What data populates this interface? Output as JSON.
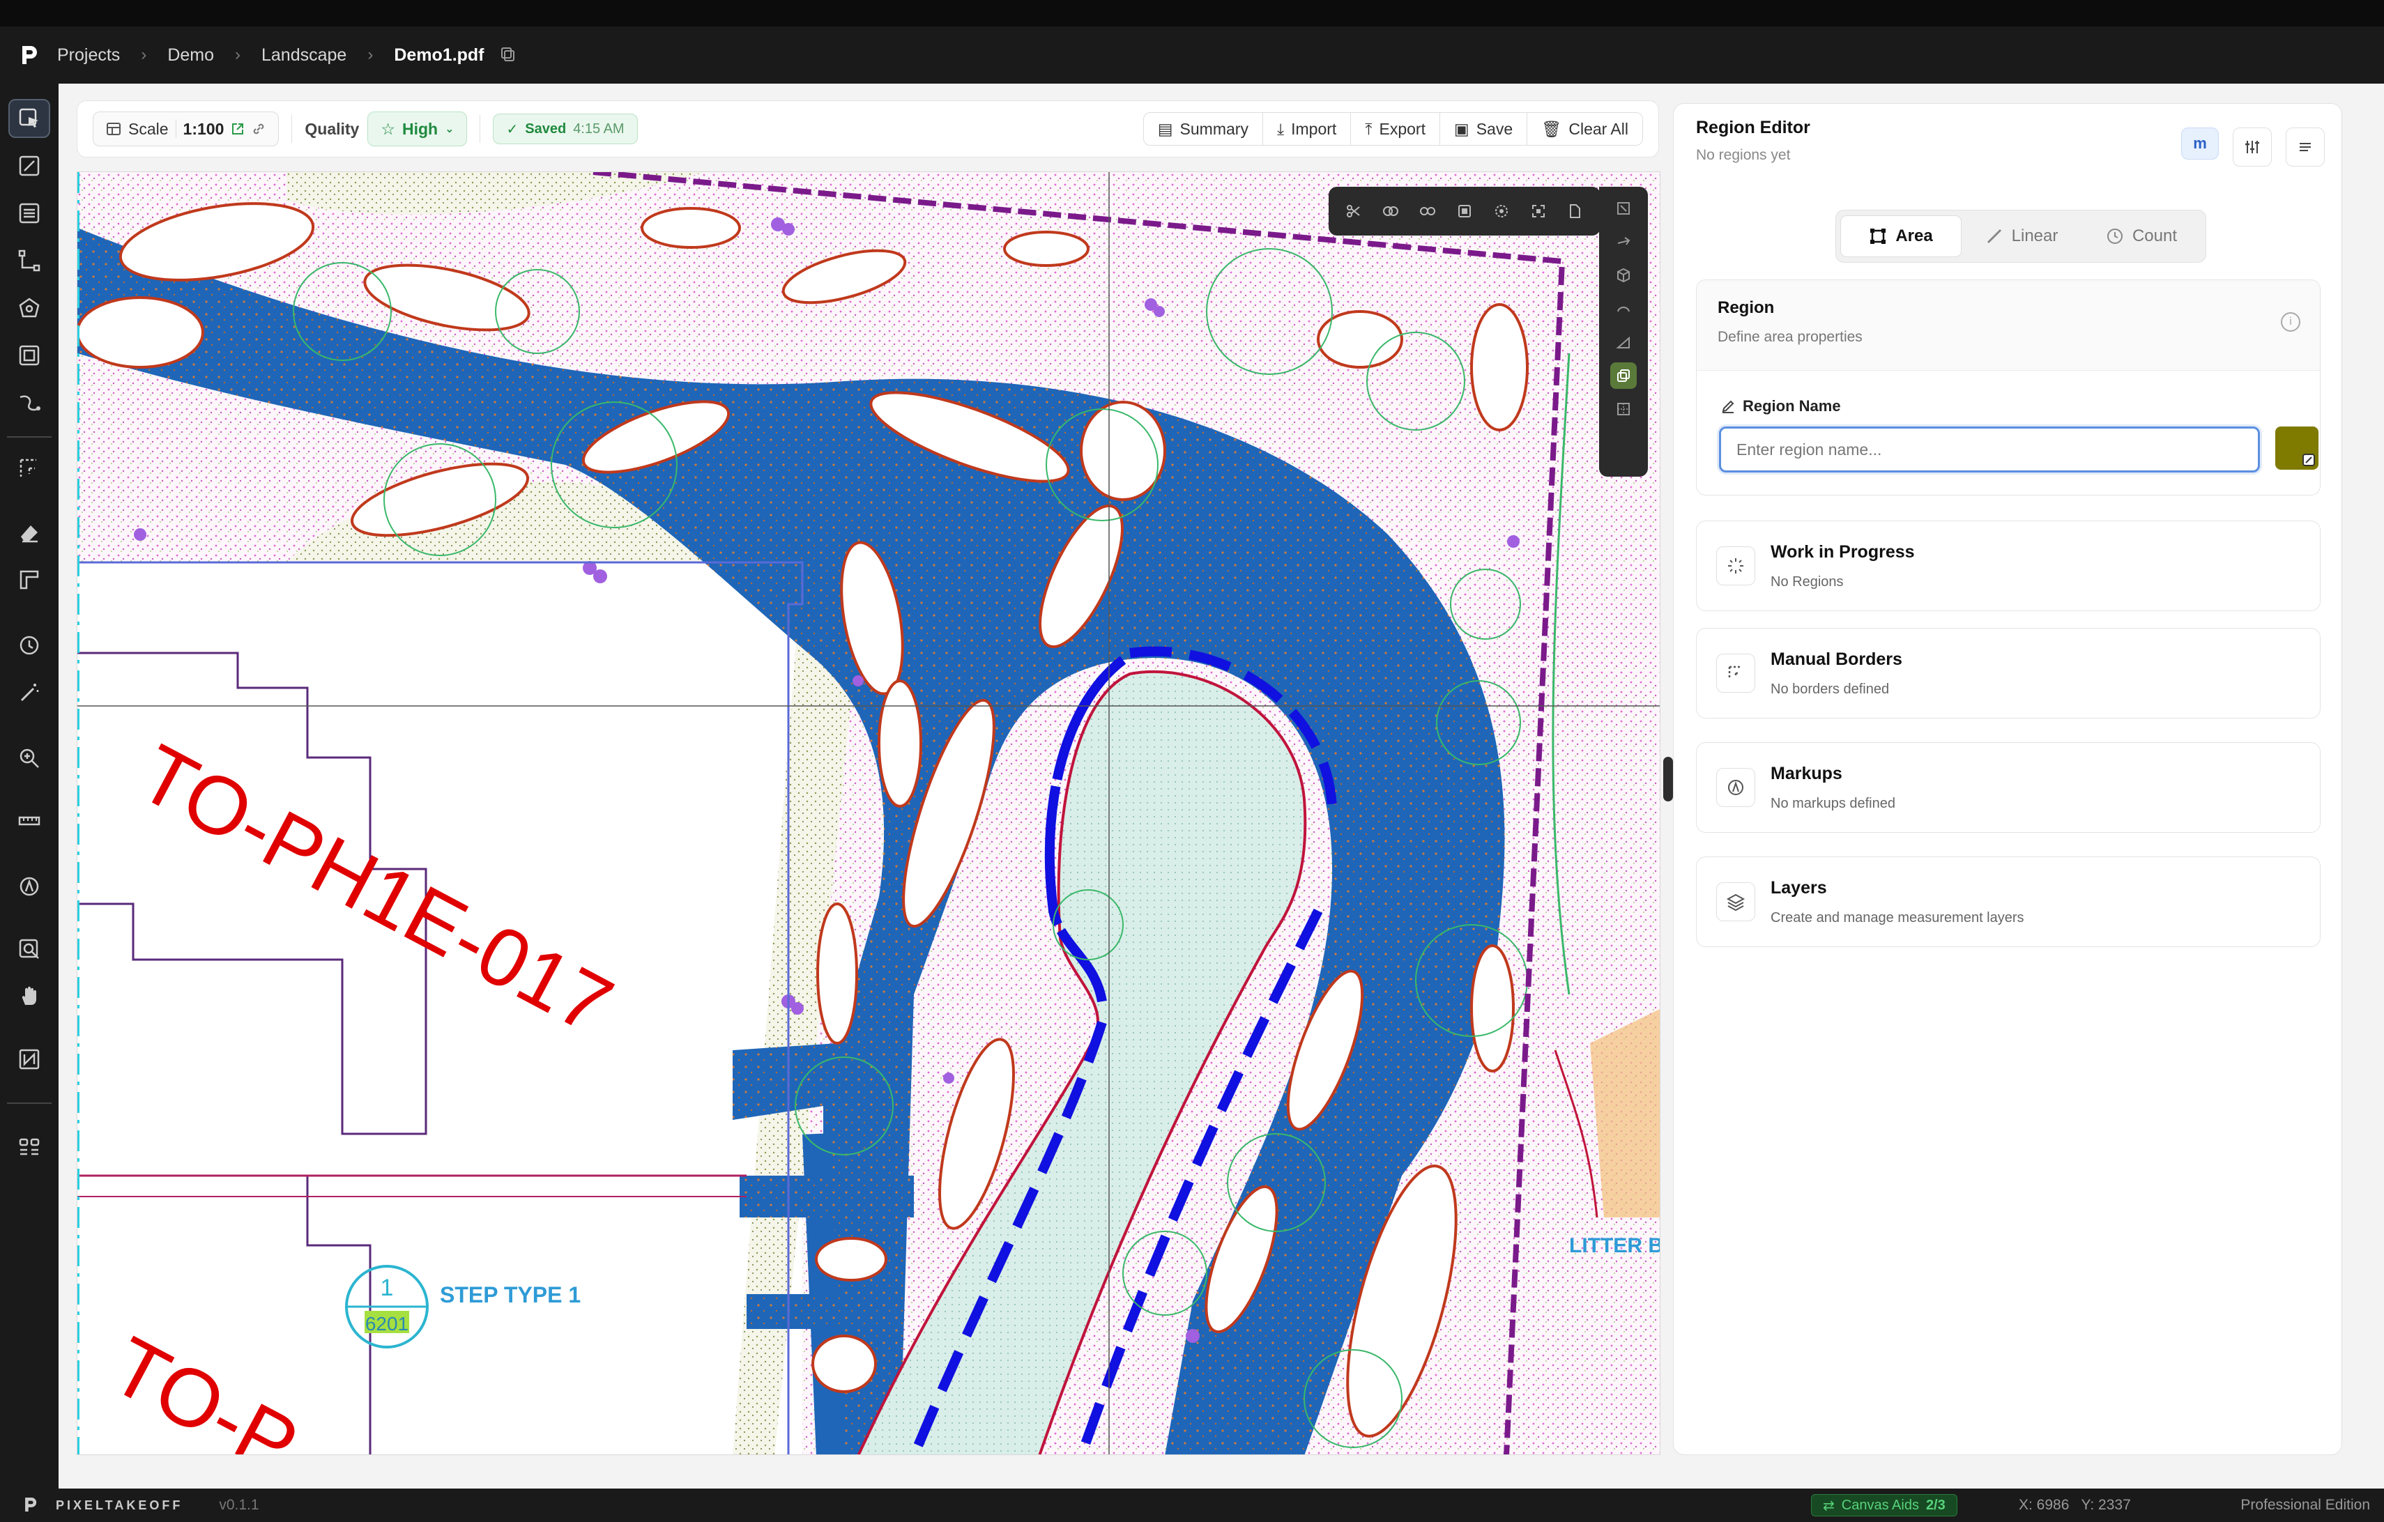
{
  "breadcrumb": {
    "items": [
      "Projects",
      "Demo",
      "Landscape"
    ],
    "current": "Demo1.pdf"
  },
  "toolbar": {
    "scale_label": "Scale",
    "scale_value": "1:100",
    "quality_label": "Quality",
    "quality_value": "High",
    "saved_label": "Saved",
    "saved_time": "4:15 AM",
    "actions": [
      "Summary",
      "Import",
      "Export",
      "Save",
      "Clear All"
    ]
  },
  "canvas": {
    "labels": {
      "building_code": "TO-PH1E-017",
      "building_code_partial": "TO-P",
      "step_type": "STEP TYPE 1",
      "step_number": "1",
      "step_ref": "6201",
      "litter": "LITTER BI"
    },
    "colors": {
      "path_fill": "#1f66b8",
      "pond_fill": "#d7ece6",
      "boundary": "#7a1a8a",
      "label_red": "#e00000",
      "label_cyan": "#2e9bd6"
    }
  },
  "region_editor": {
    "title": "Region Editor",
    "subtitle": "No regions yet",
    "m_badge": "m",
    "tabs": [
      "Area",
      "Linear",
      "Count"
    ],
    "active_tab": "Area",
    "region": {
      "title": "Region",
      "subtitle": "Define area properties",
      "name_label": "Region Name",
      "name_placeholder": "Enter region name...",
      "swatch_color": "#7f7a00"
    },
    "sections": [
      {
        "title": "Work in Progress",
        "subtitle": "No Regions"
      },
      {
        "title": "Manual Borders",
        "subtitle": "No borders defined"
      },
      {
        "title": "Markups",
        "subtitle": "No markups defined"
      },
      {
        "title": "Layers",
        "subtitle": "Create and manage measurement layers"
      }
    ]
  },
  "statusbar": {
    "brand": "PIXELTAKEOFF",
    "version": "v0.1.1",
    "canvas_aids": "Canvas Aids",
    "canvas_aids_count": "2/3",
    "x": "X: 6986",
    "y": "Y: 2337",
    "edition": "Professional Edition"
  },
  "icons": {
    "left_tools": [
      "select-icon",
      "edit-icon",
      "layers-list-icon",
      "line-icon",
      "polygon-icon",
      "area-icon",
      "curve-icon",
      "border-icon",
      "eraser-icon",
      "ruler-icon",
      "count-icon",
      "magic-wand-icon",
      "zoom-icon",
      "measure-icon",
      "markup-icon",
      "search-plan-icon",
      "hand-icon",
      "compare-icon",
      "grid-icon"
    ]
  }
}
